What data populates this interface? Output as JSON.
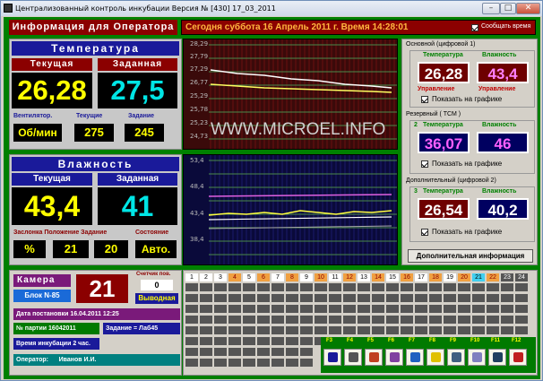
{
  "window": {
    "title": "Централизованный контроль инкубации   Версия № [430] 17_03_2011"
  },
  "header": {
    "info_label": "Информация  для  Оператора",
    "date_text": "Сегодня    суббота    16 Апрель 2011 г.  Время  14:28:01",
    "notify_label": "Сообщать время"
  },
  "temperature": {
    "title": "Температура",
    "current_label": "Текущая",
    "target_label": "Заданная",
    "current": "26,28",
    "target": "27,5",
    "fan_label": "Вентилятор.",
    "fan_current_label": "Текущие",
    "fan_target_label": "Задание",
    "fan_unit": "Об/мин",
    "fan_current": "275",
    "fan_target": "245"
  },
  "temp_chart": {
    "ticks": [
      "28,29",
      "27,79",
      "27,29",
      "26,77",
      "25,29",
      "25,78",
      "25,23",
      "24,73"
    ],
    "watermark": "WWW.MICROEL.INFO"
  },
  "humidity": {
    "title": "Влажность",
    "current_label": "Текущая",
    "target_label": "Заданная",
    "current": "43,4",
    "target": "41",
    "damper_labels": "Заслонка Положение Задание",
    "state_label": "Состояние",
    "unit": "%",
    "position": "21",
    "set": "20",
    "state": "Авто."
  },
  "hum_chart": {
    "ticks": [
      "53,4",
      "48,4",
      "43,4",
      "38,4"
    ]
  },
  "sensors": {
    "main_title": "Основной (цифровой 1)",
    "temp_label": "Температура",
    "hum_label": "Влажность",
    "main_temp": "26,28",
    "main_hum": "43,4",
    "control_label": "Управление",
    "show_chart": "Показать на графике",
    "reserve_title": "Резервный  ( ТСМ )",
    "reserve_num": "2",
    "reserve_temp": "36,07",
    "reserve_hum": "46",
    "extra_title": "Дополнительный (цифровой 2)",
    "extra_num": "3",
    "extra_temp": "26,54",
    "extra_hum": "40,2",
    "more_button": "Дополнительная информация"
  },
  "camera": {
    "label": "Камера",
    "block": "Блок N-85",
    "number": "21",
    "counter_label": "Счетчик пов.",
    "counter": "0",
    "status": "Выводная",
    "date_label": "Дата  постановки  16.04.2011  12:25",
    "batch": "№ партии 16042011",
    "task": "Задание = Лаб45",
    "incubation": "Время  инкубации  2 час.",
    "operator": "Оператор:      Иванов И.И."
  },
  "grid": {
    "headers": [
      "1",
      "2",
      "3",
      "4",
      "5",
      "6",
      "7",
      "8",
      "9",
      "10",
      "11",
      "12",
      "13",
      "14",
      "15",
      "16",
      "17",
      "18",
      "19",
      "20",
      "21",
      "22",
      "23",
      "24"
    ]
  },
  "fkeys": [
    "F3",
    "F4",
    "F5",
    "F6",
    "F7",
    "F8",
    "F9",
    "F10",
    "F11",
    "F12"
  ],
  "colors": {
    "green_frame": "#008000",
    "dark_red": "#8b0000",
    "navy": "#1a1a9a",
    "yellow_digits": "#ffff00",
    "cyan_digits": "#00e5e5",
    "active_col": "#f0a040"
  }
}
